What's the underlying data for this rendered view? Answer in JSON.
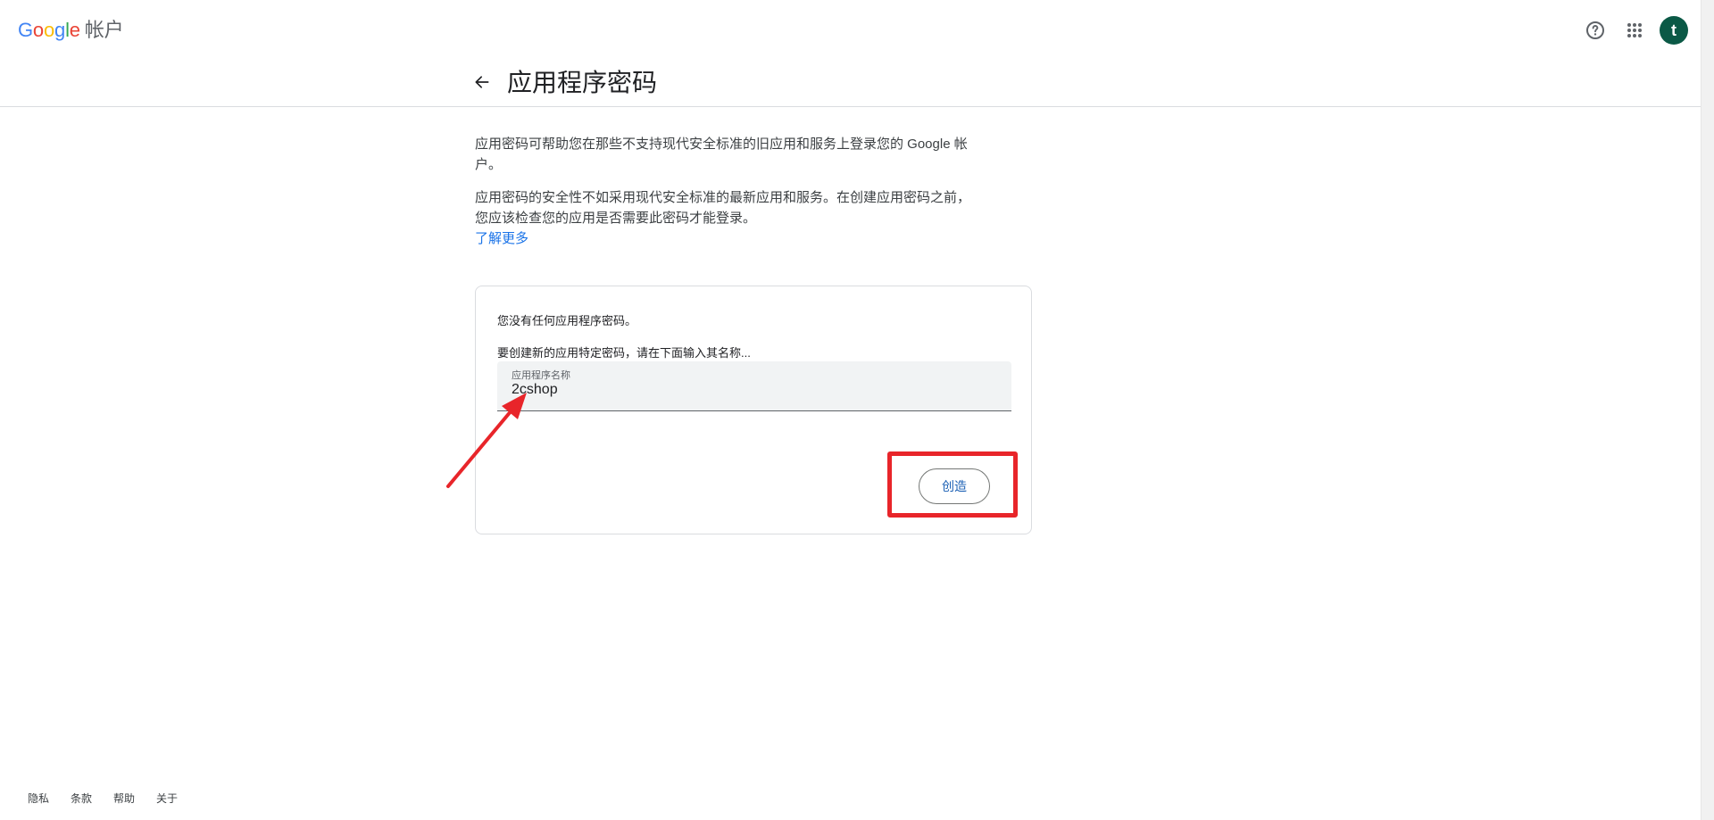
{
  "header": {
    "logo_letters": [
      "G",
      "o",
      "o",
      "g",
      "l",
      "e"
    ],
    "logo_colors": [
      "#4285F4",
      "#EA4335",
      "#FBBC05",
      "#4285F4",
      "#34A853",
      "#EA4335"
    ],
    "product_name": "帐户",
    "icons": [
      "help-circle-icon",
      "apps-grid-icon"
    ],
    "avatar_letter": "t",
    "avatar_color": "#0b5946"
  },
  "page": {
    "title": "应用程序密码",
    "back_icon": "arrow-left-icon"
  },
  "content": {
    "intro_paragraph": "应用密码可帮助您在那些不支持现代安全标准的旧应用和服务上登录您的 Google 帐户。",
    "warning_paragraph": "应用密码的安全性不如采用现代安全标准的最新应用和服务。在创建应用密码之前，您应该检查您的应用是否需要此密码才能登录。",
    "learn_more": "了解更多"
  },
  "card": {
    "no_passwords_text": "您没有任何应用程序密码。",
    "instruction_text": "要创建新的应用特定密码，请在下面输入其名称...",
    "field_label": "应用程序名称",
    "field_value": "2cshop",
    "create_button": "创造"
  },
  "annotations": {
    "highlight_color": "#e8252a"
  },
  "footer": {
    "links": [
      "隐私",
      "条款",
      "帮助",
      "关于"
    ]
  }
}
